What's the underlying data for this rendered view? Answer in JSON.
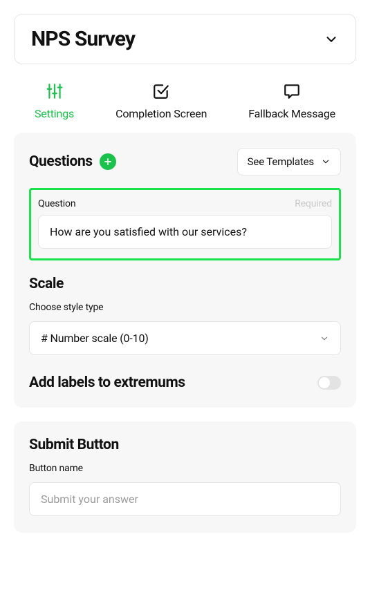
{
  "header": {
    "title": "NPS Survey"
  },
  "tabs": {
    "settings": "Settings",
    "completion": "Completion Screen",
    "fallback": "Fallback Message"
  },
  "questions": {
    "title": "Questions",
    "templates_label": "See Templates",
    "field_label": "Question",
    "required_label": "Required",
    "value": "How are you satisfied with our services?"
  },
  "scale": {
    "title": "Scale",
    "style_label": "Choose style type",
    "selected": "# Number scale (0-10)"
  },
  "extremums": {
    "title": "Add labels to extremums"
  },
  "submit": {
    "title": "Submit Button",
    "field_label": "Button name",
    "placeholder": "Submit your answer"
  }
}
